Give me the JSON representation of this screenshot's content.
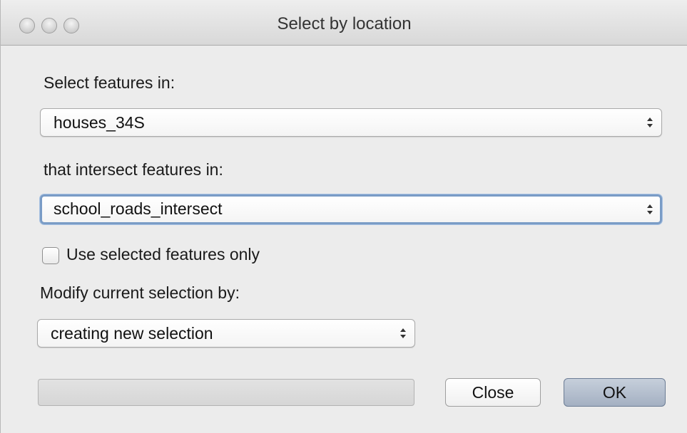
{
  "window": {
    "title": "Select by location"
  },
  "form": {
    "select_features_label": "Select features in:",
    "select_features_value": "houses_34S",
    "intersect_label": "that intersect features in:",
    "intersect_value": "school_roads_intersect",
    "use_selected_label": "Use selected features only",
    "use_selected_checked": false,
    "modify_label": "Modify current selection by:",
    "modify_value": "creating new selection"
  },
  "progress": {
    "value": 0
  },
  "buttons": {
    "close_label": "Close",
    "ok_label": "OK"
  },
  "colors": {
    "focus_ring": "#7a9cc6",
    "default_button": "#a4b0c2"
  }
}
